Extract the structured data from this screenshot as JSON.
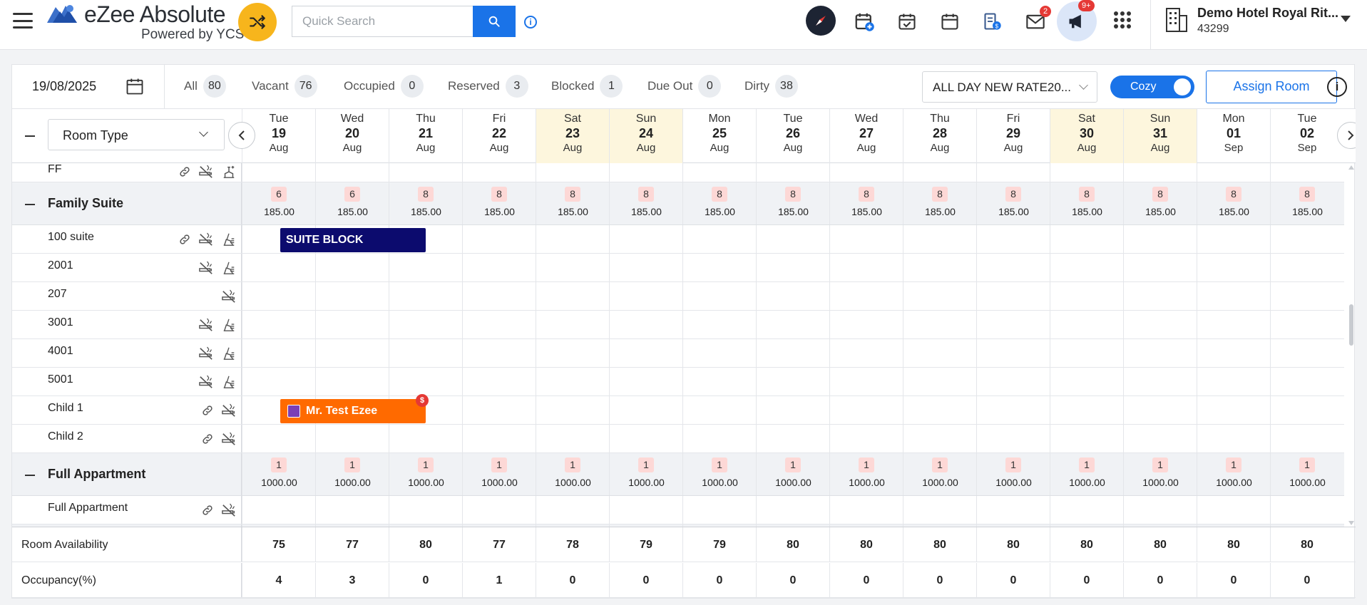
{
  "app": {
    "title": "eZee Absolute",
    "subtitle": "Powered by YCS"
  },
  "search": {
    "placeholder": "Quick Search"
  },
  "notifications": {
    "mail_count": "2",
    "announcements_count": "9+"
  },
  "hotel": {
    "name": "Demo Hotel Royal Rit...",
    "code": "43299"
  },
  "filters": {
    "date": "19/08/2025",
    "stats": [
      {
        "label": "All",
        "count": "80"
      },
      {
        "label": "Vacant",
        "count": "76"
      },
      {
        "label": "Occupied",
        "count": "0"
      },
      {
        "label": "Reserved",
        "count": "3"
      },
      {
        "label": "Blocked",
        "count": "1"
      },
      {
        "label": "Due Out",
        "count": "0"
      },
      {
        "label": "Dirty",
        "count": "38"
      }
    ],
    "rate_plan": "ALL DAY NEW RATE20...",
    "view_toggle": "Cozy",
    "assign_room": "Assign Room"
  },
  "grid": {
    "room_type_select": "Room Type",
    "days": [
      {
        "dow": "Tue",
        "date": "19",
        "month": "Aug",
        "weekend": false
      },
      {
        "dow": "Wed",
        "date": "20",
        "month": "Aug",
        "weekend": false
      },
      {
        "dow": "Thu",
        "date": "21",
        "month": "Aug",
        "weekend": false
      },
      {
        "dow": "Fri",
        "date": "22",
        "month": "Aug",
        "weekend": false
      },
      {
        "dow": "Sat",
        "date": "23",
        "month": "Aug",
        "weekend": true
      },
      {
        "dow": "Sun",
        "date": "24",
        "month": "Aug",
        "weekend": true
      },
      {
        "dow": "Mon",
        "date": "25",
        "month": "Aug",
        "weekend": false
      },
      {
        "dow": "Tue",
        "date": "26",
        "month": "Aug",
        "weekend": false
      },
      {
        "dow": "Wed",
        "date": "27",
        "month": "Aug",
        "weekend": false
      },
      {
        "dow": "Thu",
        "date": "28",
        "month": "Aug",
        "weekend": false
      },
      {
        "dow": "Fri",
        "date": "29",
        "month": "Aug",
        "weekend": false
      },
      {
        "dow": "Sat",
        "date": "30",
        "month": "Aug",
        "weekend": true
      },
      {
        "dow": "Sun",
        "date": "31",
        "month": "Aug",
        "weekend": true
      },
      {
        "dow": "Mon",
        "date": "01",
        "month": "Sep",
        "weekend": false
      },
      {
        "dow": "Tue",
        "date": "02",
        "month": "Sep",
        "weekend": false
      }
    ],
    "rows": [
      {
        "type": "room",
        "name": "FF",
        "icons": [
          "link",
          "no-smoking",
          "clean"
        ]
      },
      {
        "type": "group",
        "name": "Family Suite",
        "availability": [
          "6",
          "6",
          "8",
          "8",
          "8",
          "8",
          "8",
          "8",
          "8",
          "8",
          "8",
          "8",
          "8",
          "8",
          "8"
        ],
        "prices": [
          "185.00",
          "185.00",
          "185.00",
          "185.00",
          "185.00",
          "185.00",
          "185.00",
          "185.00",
          "185.00",
          "185.00",
          "185.00",
          "185.00",
          "185.00",
          "185.00",
          "185.00"
        ]
      },
      {
        "type": "room",
        "name": "100 suite",
        "icons": [
          "link",
          "no-smoking",
          "dirty"
        ]
      },
      {
        "type": "room",
        "name": "2001",
        "icons": [
          "no-smoking",
          "dirty"
        ]
      },
      {
        "type": "room",
        "name": "207",
        "icons": [
          "no-smoking"
        ]
      },
      {
        "type": "room",
        "name": "3001",
        "icons": [
          "no-smoking",
          "dirty"
        ]
      },
      {
        "type": "room",
        "name": "4001",
        "icons": [
          "no-smoking",
          "dirty"
        ]
      },
      {
        "type": "room",
        "name": "5001",
        "icons": [
          "no-smoking",
          "dirty"
        ]
      },
      {
        "type": "room",
        "name": "Child 1",
        "icons": [
          "link",
          "no-smoking"
        ]
      },
      {
        "type": "room",
        "name": "Child 2",
        "icons": [
          "link",
          "no-smoking"
        ]
      },
      {
        "type": "group",
        "name": "Full Appartment",
        "availability": [
          "1",
          "1",
          "1",
          "1",
          "1",
          "1",
          "1",
          "1",
          "1",
          "1",
          "1",
          "1",
          "1",
          "1",
          "1"
        ],
        "prices": [
          "1000.00",
          "1000.00",
          "1000.00",
          "1000.00",
          "1000.00",
          "1000.00",
          "1000.00",
          "1000.00",
          "1000.00",
          "1000.00",
          "1000.00",
          "1000.00",
          "1000.00",
          "1000.00",
          "1000.00"
        ]
      },
      {
        "type": "room",
        "name": "Full Appartment",
        "icons": [
          "link",
          "no-smoking"
        ]
      }
    ],
    "bookings": [
      {
        "kind": "block",
        "label": "SUITE BLOCK",
        "row": 2,
        "start_day": 0,
        "nights": 2
      },
      {
        "kind": "guest",
        "label": "Mr. Test Ezee",
        "row": 8,
        "start_day": 0,
        "nights": 2,
        "payment_flag": "$"
      }
    ]
  },
  "summary": {
    "rows": [
      {
        "label": "Room Availability",
        "values": [
          "75",
          "77",
          "80",
          "77",
          "78",
          "79",
          "79",
          "80",
          "80",
          "80",
          "80",
          "80",
          "80",
          "80",
          "80"
        ]
      },
      {
        "label": "Occupancy(%)",
        "values": [
          "4",
          "3",
          "0",
          "1",
          "0",
          "0",
          "0",
          "0",
          "0",
          "0",
          "0",
          "0",
          "0",
          "0",
          "0"
        ]
      }
    ]
  }
}
